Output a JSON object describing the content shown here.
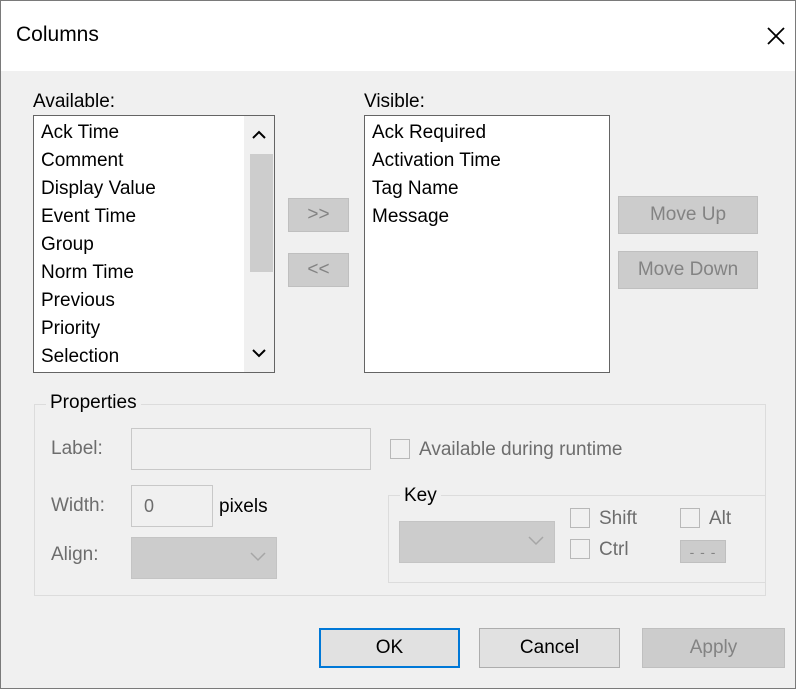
{
  "window": {
    "title": "Columns"
  },
  "available": {
    "label": "Available:",
    "items": [
      "Ack Time",
      "Comment",
      "Display Value",
      "Event Time",
      "Group",
      "Norm Time",
      "Previous",
      "Priority",
      "Selection"
    ]
  },
  "visible": {
    "label": "Visible:",
    "items": [
      "Ack Required",
      "Activation Time",
      "Tag Name",
      "Message"
    ]
  },
  "transfer": {
    "add_label": ">>",
    "remove_label": "<<"
  },
  "order": {
    "move_up_label": "Move Up",
    "move_down_label": "Move Down"
  },
  "properties": {
    "title": "Properties",
    "label_caption": "Label:",
    "label_value": "",
    "available_runtime_label": "Available during runtime",
    "width_caption": "Width:",
    "width_value": "0",
    "pixels_label": "pixels",
    "align_caption": "Align:",
    "align_value": ""
  },
  "key": {
    "title": "Key",
    "value": "",
    "shift_label": "Shift",
    "ctrl_label": "Ctrl",
    "alt_label": "Alt",
    "extra_label": "- - -"
  },
  "footer": {
    "ok_label": "OK",
    "cancel_label": "Cancel",
    "apply_label": "Apply"
  }
}
